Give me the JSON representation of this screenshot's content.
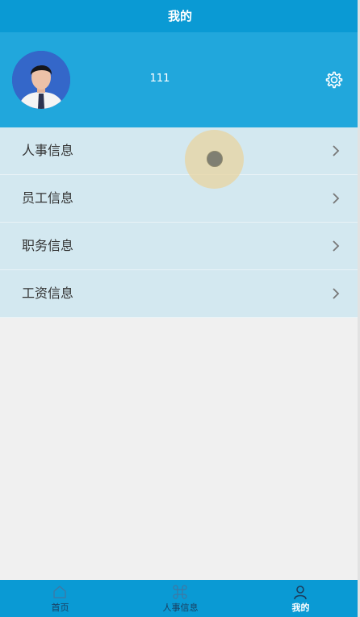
{
  "header": {
    "title": "我的"
  },
  "profile": {
    "username": "111",
    "avatar_icon": "user-photo",
    "settings_icon": "gear-icon"
  },
  "menu": {
    "items": [
      {
        "label": "人事信息",
        "icon": "chevron-right-icon"
      },
      {
        "label": "员工信息",
        "icon": "chevron-right-icon"
      },
      {
        "label": "职务信息",
        "icon": "chevron-right-icon"
      },
      {
        "label": "工资信息",
        "icon": "chevron-right-icon"
      }
    ]
  },
  "tabbar": {
    "tabs": [
      {
        "label": "首页",
        "icon": "home-icon",
        "active": false
      },
      {
        "label": "人事信息",
        "icon": "command-icon",
        "active": false
      },
      {
        "label": "我的",
        "icon": "person-icon",
        "active": true
      }
    ]
  },
  "colors": {
    "header": "#0a9ad4",
    "profile_bg": "#21a7dc",
    "menu_bg": "#d3e8f0",
    "page_bg": "#f0f0f0"
  }
}
